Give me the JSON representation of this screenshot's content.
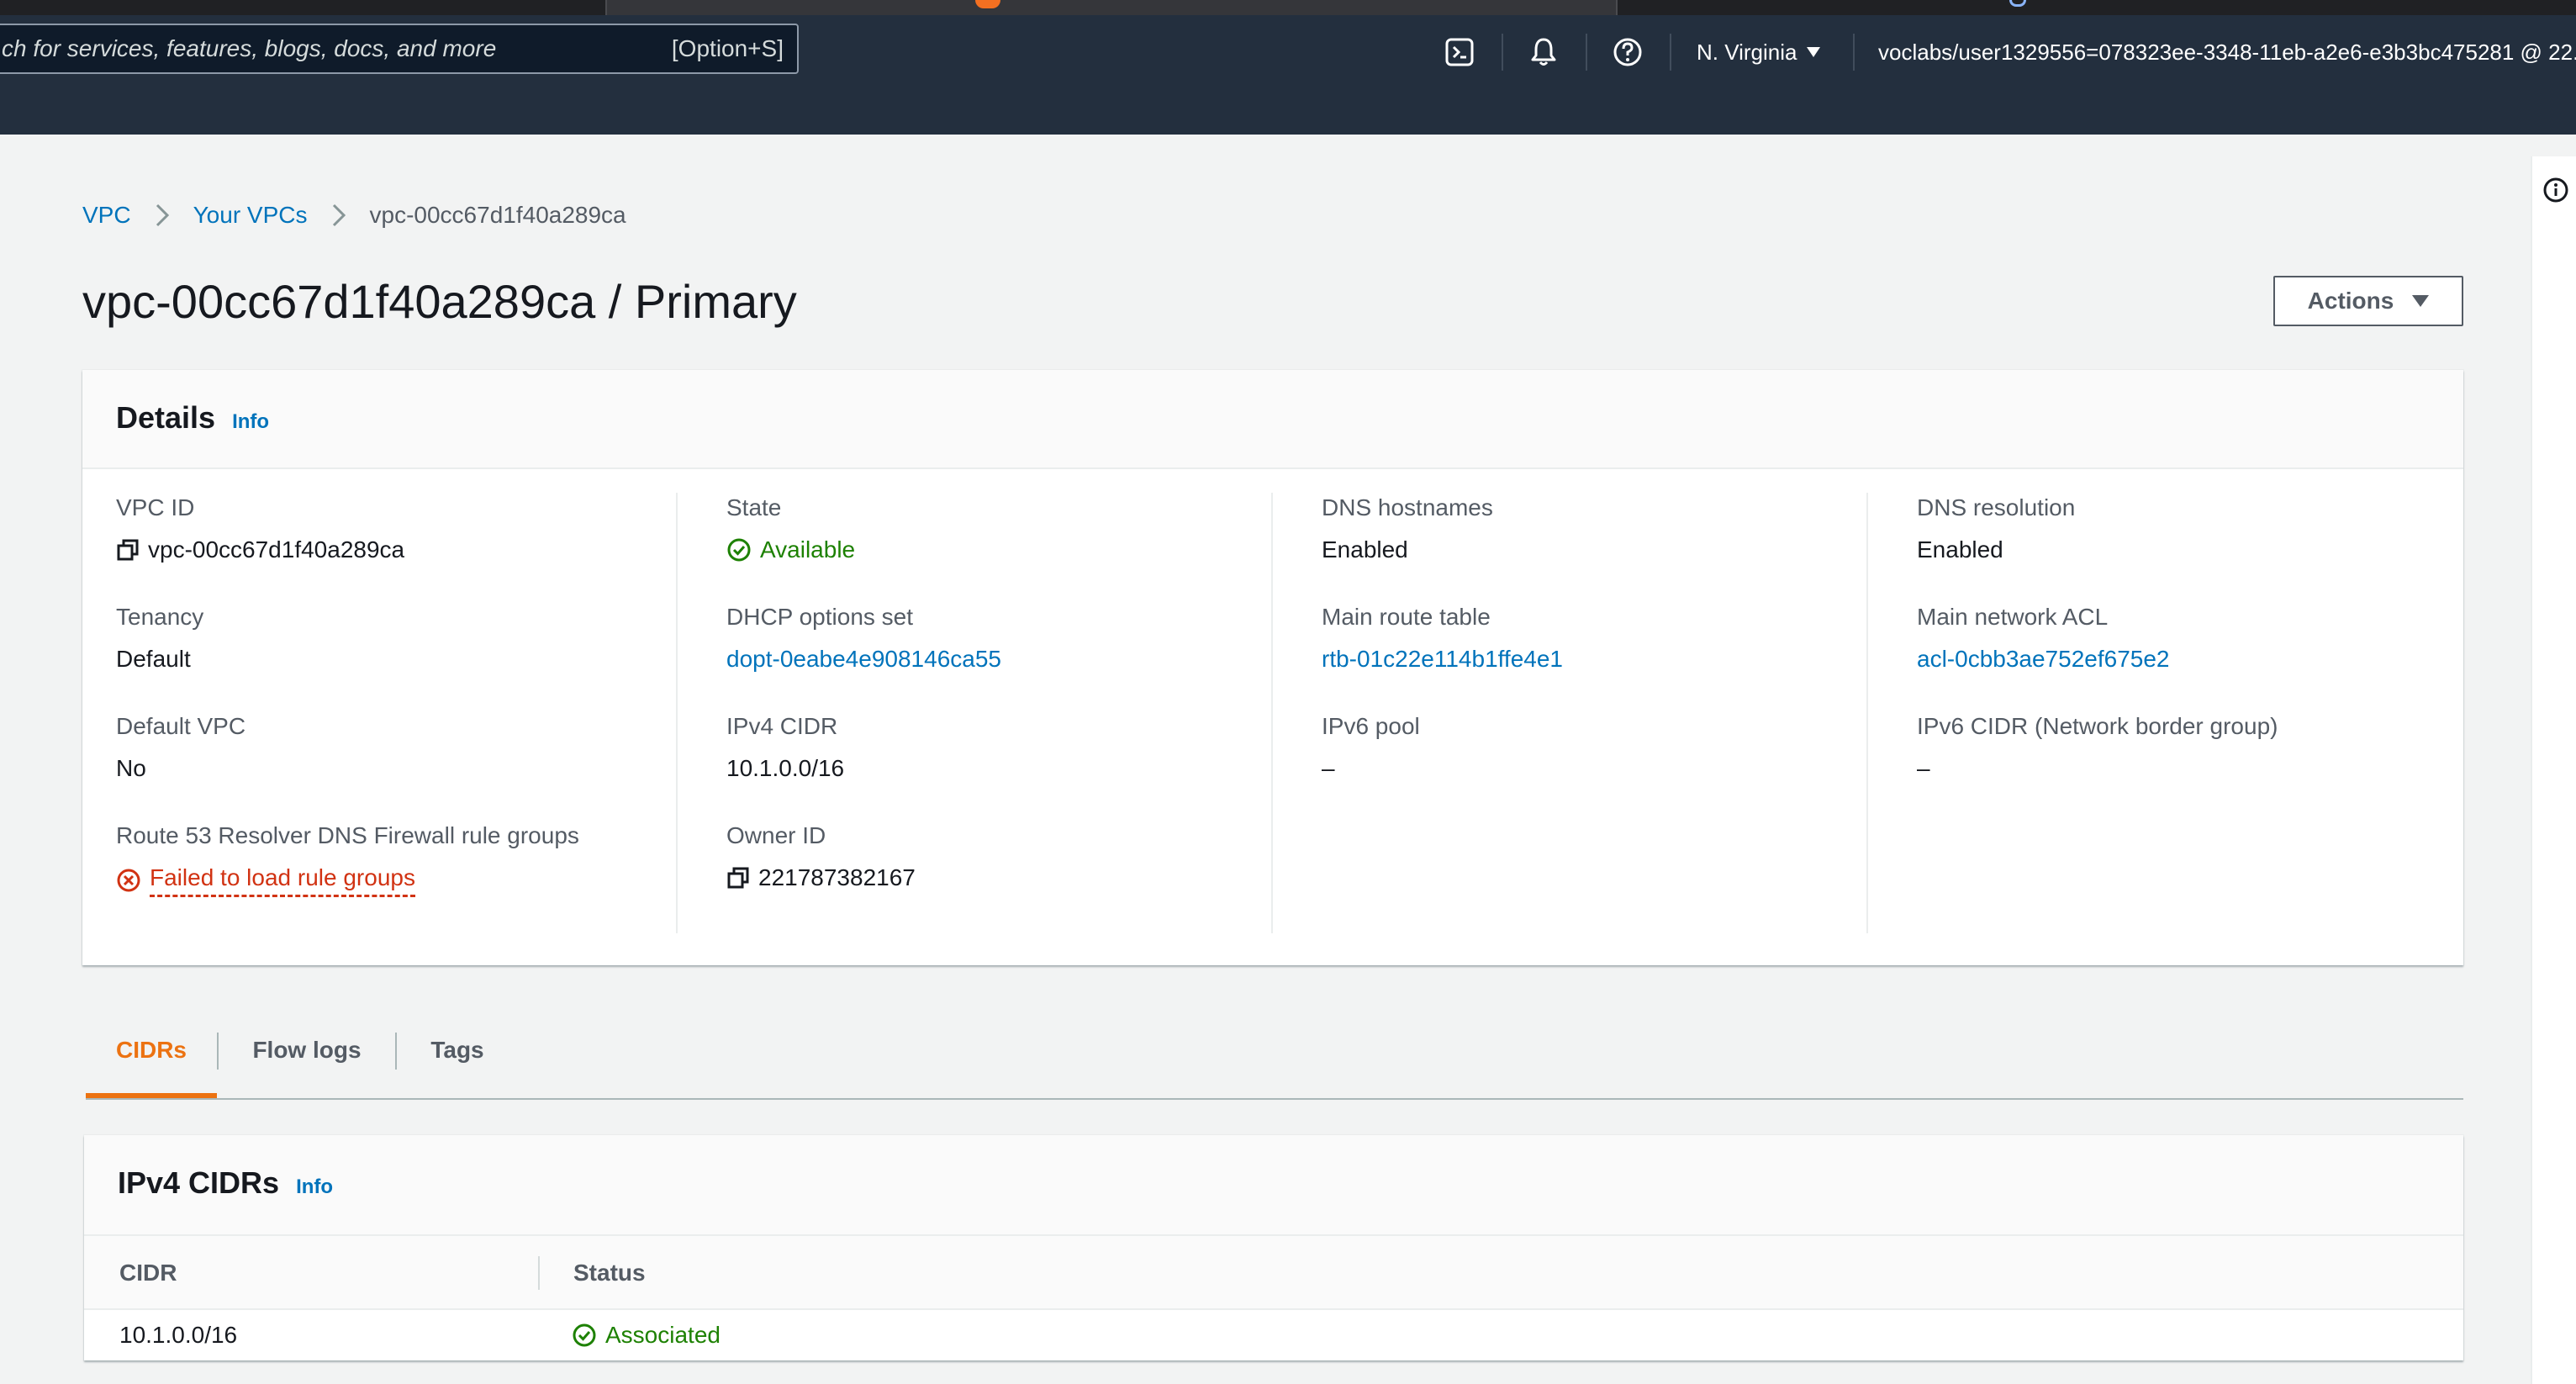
{
  "topnav": {
    "search_placeholder": "ch for services, features, blogs, docs, and more",
    "search_shortcut": "[Option+S]",
    "region": "N. Virginia",
    "account": "voclabs/user1329556=078323ee-3348-11eb-a2e6-e3b3bc475281 @ 22..."
  },
  "breadcrumb": {
    "items": [
      "VPC",
      "Your VPCs"
    ],
    "current": "vpc-00cc67d1f40a289ca"
  },
  "page": {
    "title": "vpc-00cc67d1f40a289ca / Primary",
    "actions_label": "Actions"
  },
  "details": {
    "title": "Details",
    "info": "Info",
    "columns": [
      [
        {
          "label": "VPC ID",
          "value": "vpc-00cc67d1f40a289ca"
        },
        {
          "label": "Tenancy",
          "value": "Default"
        },
        {
          "label": "Default VPC",
          "value": "No"
        },
        {
          "label": "Route 53 Resolver DNS Firewall rule groups",
          "value": "Failed to load rule groups"
        }
      ],
      [
        {
          "label": "State",
          "value": "Available"
        },
        {
          "label": "DHCP options set",
          "value": "dopt-0eabe4e908146ca55"
        },
        {
          "label": "IPv4 CIDR",
          "value": "10.1.0.0/16"
        },
        {
          "label": "Owner ID",
          "value": "221787382167"
        }
      ],
      [
        {
          "label": "DNS hostnames",
          "value": "Enabled"
        },
        {
          "label": "Main route table",
          "value": "rtb-01c22e114b1ffe4e1"
        },
        {
          "label": "IPv6 pool",
          "value": "–"
        }
      ],
      [
        {
          "label": "DNS resolution",
          "value": "Enabled"
        },
        {
          "label": "Main network ACL",
          "value": "acl-0cbb3ae752ef675e2"
        },
        {
          "label": "IPv6 CIDR (Network border group)",
          "value": "–"
        }
      ]
    ]
  },
  "tabs": [
    "CIDRs",
    "Flow logs",
    "Tags"
  ],
  "ipv4_cidrs": {
    "title": "IPv4 CIDRs",
    "info": "Info",
    "columns": [
      "CIDR",
      "Status"
    ],
    "rows": [
      {
        "cidr": "10.1.0.0/16",
        "status": "Associated"
      }
    ]
  },
  "colors": {
    "nav_bg": "#232f3e",
    "link": "#0073bb",
    "success": "#1d8102",
    "error": "#d13212",
    "active_tab": "#ec7211"
  }
}
